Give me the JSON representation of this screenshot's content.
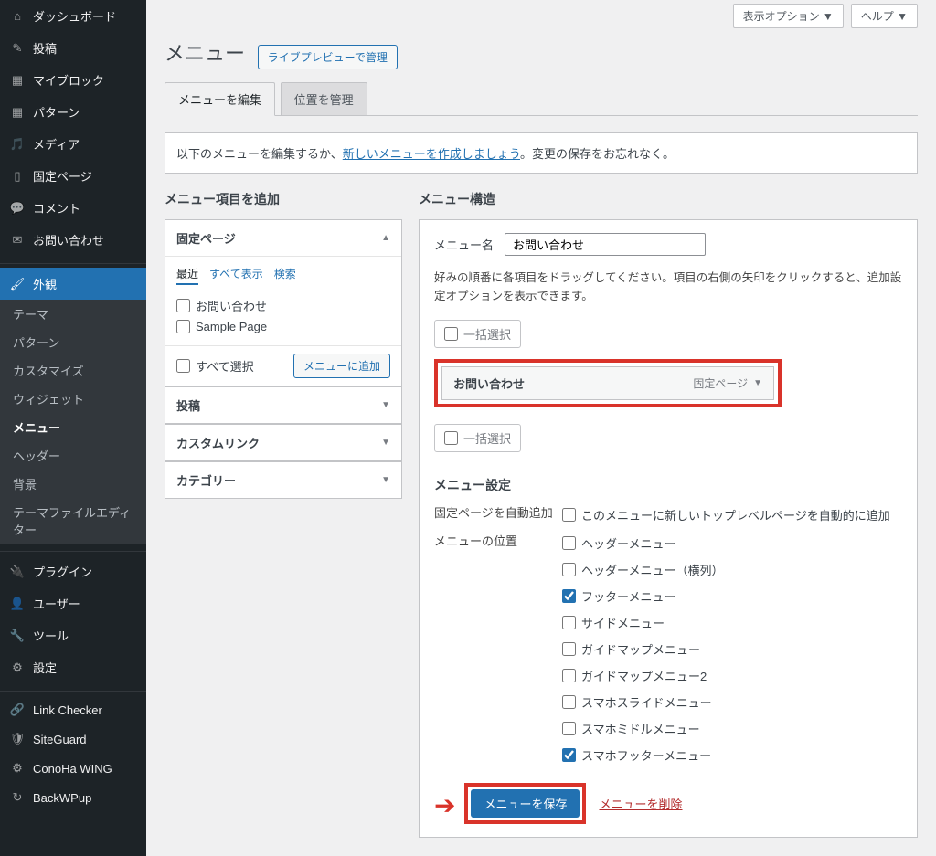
{
  "topbar": {
    "display_options": "表示オプション ▼",
    "help": "ヘルプ ▼"
  },
  "header": {
    "title": "メニュー",
    "live_preview": "ライブプレビューで管理"
  },
  "tabs": {
    "edit": "メニューを編集",
    "locations": "位置を管理"
  },
  "notice": {
    "pre": "以下のメニューを編集するか、",
    "link": "新しいメニューを作成しましょう",
    "post": "。変更の保存をお忘れなく。"
  },
  "sidebar": {
    "items": [
      {
        "icon": "⌂",
        "label": "ダッシュボード"
      },
      {
        "icon": "✎",
        "label": "投稿"
      },
      {
        "icon": "▦",
        "label": "マイブロック"
      },
      {
        "icon": "▦",
        "label": "パターン"
      },
      {
        "icon": "🎵",
        "label": "メディア"
      },
      {
        "icon": "▯",
        "label": "固定ページ"
      },
      {
        "icon": "💬",
        "label": "コメント"
      },
      {
        "icon": "✉",
        "label": "お問い合わせ"
      }
    ],
    "appearance": {
      "icon": "🖌",
      "label": "外観"
    },
    "subs": [
      "テーマ",
      "パターン",
      "カスタマイズ",
      "ウィジェット",
      "メニュー",
      "ヘッダー",
      "背景",
      "テーマファイルエディター"
    ],
    "items2": [
      {
        "icon": "🔌",
        "label": "プラグイン"
      },
      {
        "icon": "👤",
        "label": "ユーザー"
      },
      {
        "icon": "🔧",
        "label": "ツール"
      },
      {
        "icon": "⚙",
        "label": "設定"
      }
    ],
    "items3": [
      {
        "icon": "🔗",
        "label": "Link Checker"
      },
      {
        "icon": "🛡",
        "label": "SiteGuard"
      },
      {
        "icon": "⚙",
        "label": "ConoHa WING"
      },
      {
        "icon": "↻",
        "label": "BackWPup"
      }
    ]
  },
  "add_items": {
    "heading": "メニュー項目を追加",
    "pages": {
      "title": "固定ページ",
      "tabs": {
        "recent": "最近",
        "all": "すべて表示",
        "search": "検索"
      },
      "items": [
        "お問い合わせ",
        "Sample Page"
      ],
      "select_all": "すべて選択",
      "add_btn": "メニューに追加"
    },
    "posts": "投稿",
    "custom_links": "カスタムリンク",
    "categories": "カテゴリー"
  },
  "structure": {
    "heading": "メニュー構造",
    "name_label": "メニュー名",
    "name_value": "お問い合わせ",
    "desc": "好みの順番に各項目をドラッグしてください。項目の右側の矢印をクリックすると、追加設定オプションを表示できます。",
    "bulk_select": "一括選択",
    "menu_item": {
      "label": "お問い合わせ",
      "type": "固定ページ"
    },
    "settings_heading": "メニュー設定",
    "auto_add_label": "固定ページを自動追加",
    "auto_add_text": "このメニューに新しいトップレベルページを自動的に追加",
    "locations_label": "メニューの位置",
    "locations": [
      {
        "label": "ヘッダーメニュー",
        "checked": false
      },
      {
        "label": "ヘッダーメニュー（横列）",
        "checked": false
      },
      {
        "label": "フッターメニュー",
        "checked": true
      },
      {
        "label": "サイドメニュー",
        "checked": false
      },
      {
        "label": "ガイドマップメニュー",
        "checked": false
      },
      {
        "label": "ガイドマップメニュー2",
        "checked": false
      },
      {
        "label": "スマホスライドメニュー",
        "checked": false
      },
      {
        "label": "スマホミドルメニュー",
        "checked": false
      },
      {
        "label": "スマホフッターメニュー",
        "checked": true
      }
    ],
    "save_btn": "メニューを保存",
    "delete_link": "メニューを削除"
  }
}
